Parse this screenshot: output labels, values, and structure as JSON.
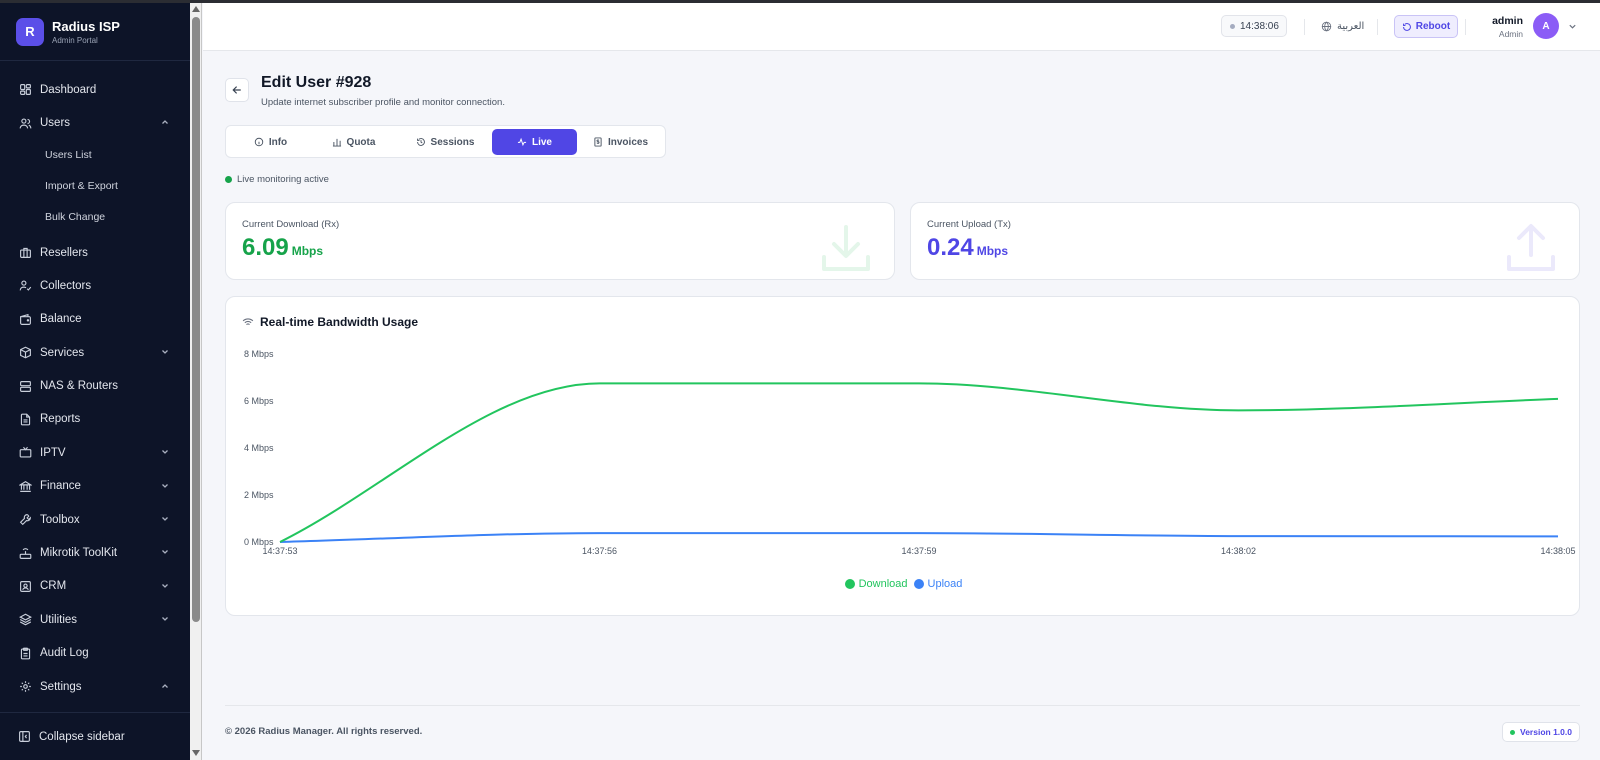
{
  "brand": {
    "logo_letter": "R",
    "name": "Radius ISP",
    "subtitle": "Admin Portal"
  },
  "sidebar": {
    "items": [
      {
        "label": "Dashboard",
        "icon": "dashboard-icon"
      },
      {
        "label": "Users",
        "icon": "users-icon",
        "expanded": true,
        "children": [
          "Users List",
          "Import & Export",
          "Bulk Change"
        ]
      },
      {
        "label": "Resellers",
        "icon": "briefcase-icon"
      },
      {
        "label": "Collectors",
        "icon": "user-check-icon"
      },
      {
        "label": "Balance",
        "icon": "wallet-icon"
      },
      {
        "label": "Services",
        "icon": "box-icon",
        "has_children": true
      },
      {
        "label": "NAS & Routers",
        "icon": "server-icon"
      },
      {
        "label": "Reports",
        "icon": "file-icon"
      },
      {
        "label": "IPTV",
        "icon": "tv-icon",
        "has_children": true
      },
      {
        "label": "Finance",
        "icon": "bank-icon",
        "has_children": true
      },
      {
        "label": "Toolbox",
        "icon": "wrench-icon",
        "has_children": true
      },
      {
        "label": "Mikrotik ToolKit",
        "icon": "router-icon",
        "has_children": true
      },
      {
        "label": "CRM",
        "icon": "contact-icon",
        "has_children": true
      },
      {
        "label": "Utilities",
        "icon": "layers-icon",
        "has_children": true
      },
      {
        "label": "Audit Log",
        "icon": "clipboard-icon"
      },
      {
        "label": "Settings",
        "icon": "gear-icon",
        "expanded": true
      }
    ],
    "collapse_label": "Collapse sidebar"
  },
  "topbar": {
    "clock": "14:38:06",
    "language": "العربية",
    "reboot_label": "Reboot",
    "user_name": "admin",
    "user_role": "Admin",
    "avatar_letter": "A"
  },
  "page": {
    "title": "Edit User #928",
    "subtitle": "Update internet subscriber profile and monitor connection.",
    "tabs": [
      {
        "label": "Info",
        "icon": "info-icon"
      },
      {
        "label": "Quota",
        "icon": "bar-chart-icon"
      },
      {
        "label": "Sessions",
        "icon": "history-icon"
      },
      {
        "label": "Live",
        "icon": "activity-icon",
        "active": true
      },
      {
        "label": "Invoices",
        "icon": "invoice-icon"
      }
    ],
    "live_status": "Live monitoring active"
  },
  "stats": {
    "download": {
      "label": "Current Download (Rx)",
      "value": "6.09",
      "unit": "Mbps",
      "color": "#16a34a"
    },
    "upload": {
      "label": "Current Upload (Tx)",
      "value": "0.24",
      "unit": "Mbps",
      "color": "#4f46e5"
    }
  },
  "chart_title": "Real-time Bandwidth Usage",
  "chart_data": {
    "type": "line",
    "x": [
      "14:37:53",
      "14:37:56",
      "14:37:59",
      "14:38:02",
      "14:38:05"
    ],
    "y_ticks": [
      "0 Mbps",
      "2 Mbps",
      "4 Mbps",
      "6 Mbps",
      "8 Mbps"
    ],
    "ylim": [
      0,
      8
    ],
    "series": [
      {
        "name": "Download",
        "color": "#22c55e",
        "values": [
          0,
          6.75,
          6.75,
          5.6,
          6.09
        ]
      },
      {
        "name": "Upload",
        "color": "#3b82f6",
        "values": [
          0,
          0.38,
          0.38,
          0.25,
          0.24
        ]
      }
    ],
    "legend": "bottom-center",
    "grid": false
  },
  "footer": {
    "copyright": "© 2026 Radius Manager. All rights reserved.",
    "version": "Version 1.0.0"
  }
}
